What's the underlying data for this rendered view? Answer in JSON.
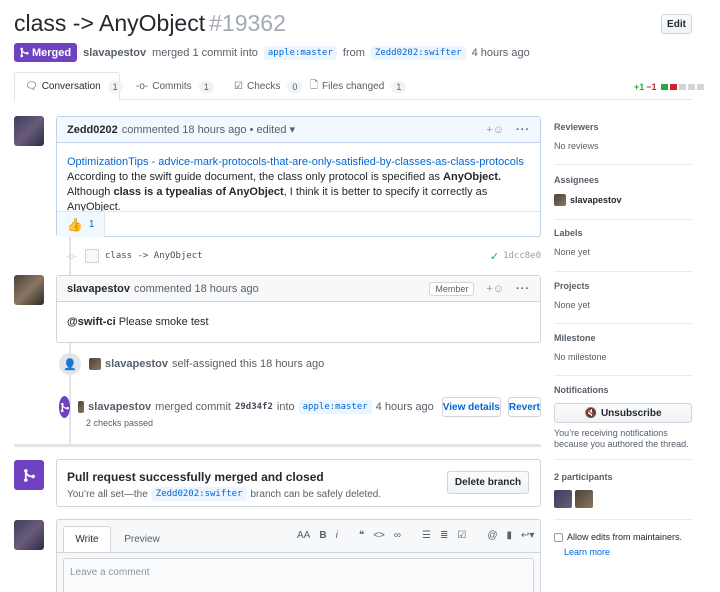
{
  "pr": {
    "title": "class -> AnyObject",
    "number": "#19362",
    "edit_label": "Edit",
    "state": "Merged",
    "author": "slavapestov",
    "merged_text": "merged 1 commit into",
    "base_branch": "apple:master",
    "from": "from",
    "head_branch": "Zedd0202:swifter",
    "time": "4 hours ago"
  },
  "tabs": [
    {
      "label": "Conversation",
      "count": "1"
    },
    {
      "label": "Commits",
      "count": "1"
    },
    {
      "label": "Checks",
      "count": "0"
    },
    {
      "label": "Files changed",
      "count": "1"
    }
  ],
  "diffstat": {
    "additions": "+1",
    "deletions": "−1"
  },
  "comment1": {
    "author": "Zedd0202",
    "meta": "commented 18 hours ago",
    "edited": "• edited ▾",
    "link": "OptimizationTips - advice-mark-protocols-that-are-only-satisfied-by-classes-as-class-protocols",
    "line2_pre": "According to the swift guide document, the class only protocol is specified as",
    "line2_bold": "AnyObject.",
    "line3_pre": "Although",
    "line3_bold": "class is a typealias of AnyObject",
    "line3_post": ", I think it is better to specify it correctly as AnyObject.",
    "reaction_count": "1"
  },
  "commit": {
    "message": "class -> AnyObject",
    "sha": "1dcc8e0"
  },
  "comment2": {
    "author": "slavapestov",
    "meta": "commented 18 hours ago",
    "badge": "Member",
    "mention": "@swift-ci",
    "text": "Please smoke test"
  },
  "event_assign": {
    "user": "slavapestov",
    "text": "self-assigned this 18 hours ago"
  },
  "event_merge": {
    "user": "slavapestov",
    "text": "merged commit",
    "sha": "29d34f2",
    "into": "into",
    "branch": "apple:master",
    "time": "4 hours ago",
    "view_details": "View details",
    "revert": "Revert",
    "checks": "2 checks passed"
  },
  "merged_box": {
    "title": "Pull request successfully merged and closed",
    "pre": "You’re all set—the",
    "branch": "Zedd0202:swifter",
    "post": "branch can be safely deleted.",
    "delete_button": "Delete branch"
  },
  "editor": {
    "write_tab": "Write",
    "preview_tab": "Preview",
    "placeholder": "Leave a comment"
  },
  "sidebar": {
    "reviewers": {
      "heading": "Reviewers",
      "value": "No reviews"
    },
    "assignees": {
      "heading": "Assignees",
      "value": "slavapestov"
    },
    "labels": {
      "heading": "Labels",
      "value": "None yet"
    },
    "projects": {
      "heading": "Projects",
      "value": "None yet"
    },
    "milestone": {
      "heading": "Milestone",
      "value": "No milestone"
    },
    "notifications": {
      "heading": "Notifications",
      "button": "Unsubscribe",
      "note": "You’re receiving notifications because you authored the thread."
    },
    "participants": {
      "heading": "2 participants"
    },
    "allow_edits": "Allow edits from maintainers.",
    "learn_more": "Learn more"
  },
  "colors": {
    "merged": "#6f42c1",
    "link": "#0366d6",
    "addition": "#28a745",
    "deletion": "#cb2431"
  }
}
